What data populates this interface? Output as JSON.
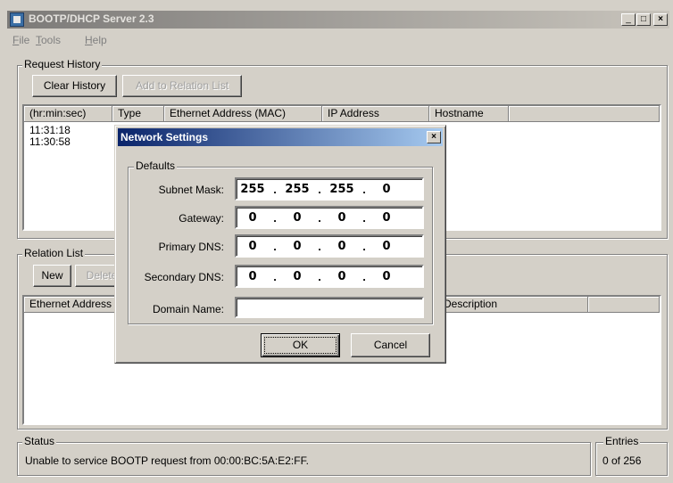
{
  "window": {
    "title": "BOOTP/DHCP Server 2.3",
    "controls": {
      "minimize": "_",
      "maximize": "□",
      "close": "×"
    }
  },
  "menu": {
    "file": {
      "accel": "F",
      "rest": "ile"
    },
    "tools": {
      "accel": "T",
      "rest": "ools"
    },
    "help": {
      "accel": "H",
      "rest": "elp"
    }
  },
  "request_history": {
    "label": "Request History",
    "clear_button": "Clear History",
    "add_button": "Add to Relation List",
    "columns": [
      "(hr:min:sec)",
      "Type",
      "Ethernet Address (MAC)",
      "IP Address",
      "Hostname"
    ],
    "rows": [
      "11:31:18",
      "11:30:58"
    ]
  },
  "relation_list": {
    "label": "Relation List",
    "new_button": "New",
    "delete_button": "Delete",
    "columns": [
      "Ethernet Address",
      "Description"
    ]
  },
  "status": {
    "label": "Status",
    "message": "Unable to service BOOTP request from 00:00:BC:5A:E2:FF.",
    "entries_label": "Entries",
    "entries_value": "0 of 256"
  },
  "dialog": {
    "title": "Network Settings",
    "close": "×",
    "defaults_label": "Defaults",
    "fields": {
      "subnet_mask": {
        "label": "Subnet Mask:",
        "octets": [
          "255",
          "255",
          "255",
          "0"
        ]
      },
      "gateway": {
        "label": "Gateway:",
        "octets": [
          "0",
          "0",
          "0",
          "0"
        ]
      },
      "primary_dns": {
        "label": "Primary DNS:",
        "octets": [
          "0",
          "0",
          "0",
          "0"
        ]
      },
      "secondary_dns": {
        "label": "Secondary DNS:",
        "octets": [
          "0",
          "0",
          "0",
          "0"
        ]
      },
      "domain_name": {
        "label": "Domain Name:",
        "value": ""
      }
    },
    "ok_button": "OK",
    "cancel_button": "Cancel"
  }
}
